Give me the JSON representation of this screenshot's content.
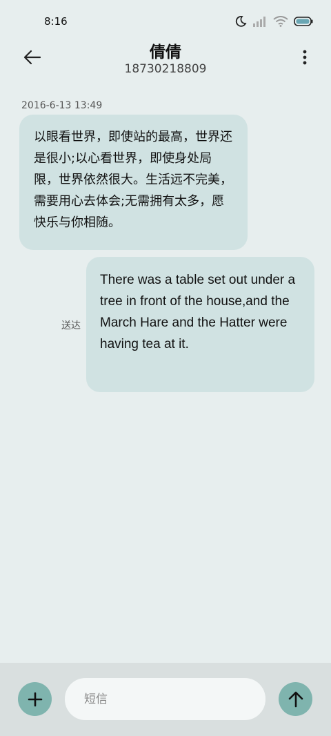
{
  "status": {
    "time": "8:16",
    "icons": [
      "moon-icon",
      "signal-icon",
      "wifi-icon",
      "battery-icon"
    ]
  },
  "header": {
    "contact_name": "倩倩",
    "phone_number": "18730218809"
  },
  "conversation": {
    "timestamp": "2016-6-13 13:49",
    "messages": [
      {
        "direction": "incoming",
        "text": "以眼看世界，即使站的最高，世界还是很小;以心看世界，即使身处局限，世界依然很大。生活远不完美，需要用心去体会;无需拥有太多，愿快乐与你相随。"
      },
      {
        "direction": "outgoing",
        "text": "There was a table set out under a tree in front of the house,and the March Hare and the Hatter were having tea at it.",
        "status": "送达"
      }
    ]
  },
  "composer": {
    "placeholder": "短信",
    "value": ""
  },
  "colors": {
    "background": "#e7eeee",
    "bubble": "#d0e2e2",
    "accent": "#7fb4ae",
    "bottom_bar": "#d9dfdf"
  }
}
